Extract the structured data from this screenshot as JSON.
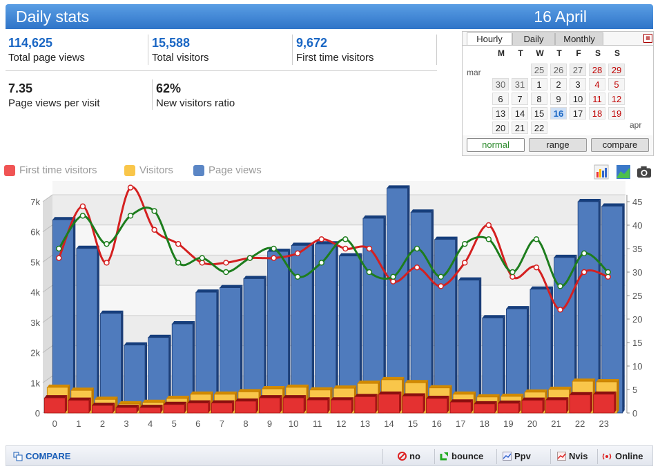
{
  "header": {
    "title": "Daily stats",
    "date": "16 April"
  },
  "stats": [
    {
      "value": "114,625",
      "label": "Total page views"
    },
    {
      "value": "15,588",
      "label": "Total visitors"
    },
    {
      "value": "9,672",
      "label": "First time visitors"
    },
    {
      "value": "7.35",
      "label": "Page views per visit"
    },
    {
      "value": "62%",
      "label": "New visitors ratio"
    }
  ],
  "calendar": {
    "tabs": [
      "Hourly",
      "Daily",
      "Monthly"
    ],
    "active_tab": "Hourly",
    "weekdays": [
      "M",
      "T",
      "W",
      "T",
      "F",
      "S",
      "S"
    ],
    "month_prev": "mar",
    "month_next": "apr",
    "days": [
      [
        "",
        "",
        "25",
        "26",
        "27",
        "28",
        "29"
      ],
      [
        "30",
        "31",
        "1",
        "2",
        "3",
        "4",
        "5"
      ],
      [
        "6",
        "7",
        "8",
        "9",
        "10",
        "11",
        "12"
      ],
      [
        "13",
        "14",
        "15",
        "16",
        "17",
        "18",
        "19"
      ],
      [
        "20",
        "21",
        "22",
        "",
        "",
        "",
        ""
      ]
    ],
    "selected_day": "16",
    "buttons": [
      "normal",
      "range",
      "compare"
    ]
  },
  "legend": [
    {
      "name": "First time visitors",
      "color": "#f05454"
    },
    {
      "name": "Visitors",
      "color": "#f9c64a"
    },
    {
      "name": "Page views",
      "color": "#5b86c5"
    }
  ],
  "icons": [
    "bar-chart-icon",
    "area-chart-icon",
    "camera-icon"
  ],
  "chart_data": {
    "type": "bar",
    "categories": [
      "0",
      "1",
      "2",
      "3",
      "4",
      "5",
      "6",
      "7",
      "8",
      "9",
      "10",
      "11",
      "12",
      "13",
      "14",
      "15",
      "16",
      "17",
      "18",
      "19",
      "20",
      "21",
      "22",
      "23"
    ],
    "left_ticks": [
      "0",
      "1k",
      "2k",
      "3k",
      "4k",
      "5k",
      "6k",
      "7k"
    ],
    "right_ticks": [
      "0",
      "5",
      "10",
      "15",
      "20",
      "25",
      "30",
      "35",
      "40",
      "45"
    ],
    "ylim_left": [
      0,
      7000
    ],
    "ylim_right": [
      0,
      45
    ],
    "series": [
      {
        "name": "Page views",
        "values": [
          6400,
          5450,
          3300,
          2250,
          2500,
          2950,
          4000,
          4150,
          4450,
          5350,
          5550,
          5600,
          5200,
          6450,
          7450,
          6650,
          5750,
          4400,
          3150,
          3450,
          4100,
          5150,
          7000,
          6850
        ]
      },
      {
        "name": "Visitors",
        "values": [
          850,
          750,
          450,
          300,
          350,
          480,
          620,
          620,
          700,
          800,
          850,
          760,
          820,
          980,
          1100,
          1000,
          830,
          620,
          530,
          550,
          690,
          780,
          1050,
          1030
        ]
      },
      {
        "name": "First time visitors",
        "values": [
          500,
          420,
          250,
          180,
          180,
          280,
          330,
          330,
          390,
          500,
          500,
          430,
          430,
          540,
          620,
          560,
          480,
          360,
          300,
          320,
          420,
          430,
          600,
          620
        ]
      }
    ],
    "lines": [
      {
        "color": "#d42020",
        "values": [
          33,
          44,
          32,
          48,
          39,
          36,
          32,
          32,
          33,
          33,
          34,
          37,
          35,
          35,
          28,
          31,
          27,
          32,
          40,
          29,
          31,
          22,
          30,
          29
        ]
      },
      {
        "color": "#1d7d1d",
        "values": [
          35,
          42,
          36,
          42,
          43,
          32,
          33,
          30,
          33,
          35,
          29,
          32,
          37,
          30,
          29,
          35,
          29,
          36,
          37,
          30,
          37,
          27,
          34,
          30
        ]
      }
    ]
  },
  "footer": {
    "compare": "COMPARE",
    "items": [
      "no",
      "bounce",
      "Ppv",
      "Nvis",
      "Online"
    ]
  }
}
